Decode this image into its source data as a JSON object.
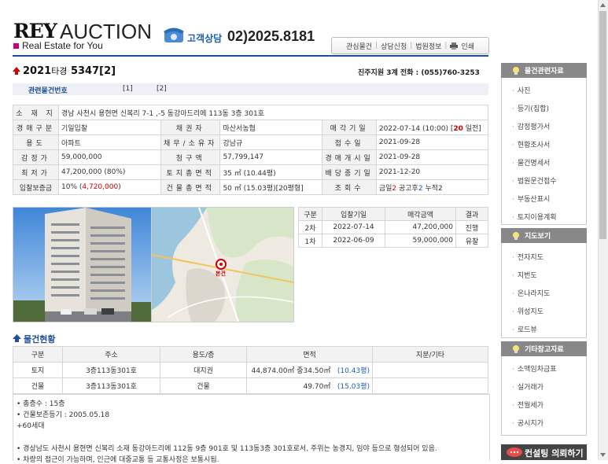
{
  "header": {
    "logo_main": "REY",
    "logo_auction": "AUCTION",
    "logo_sub": "Real Estate for You",
    "phone_label": "고객상담",
    "phone_number": "02)2025.8181",
    "top_links": [
      "관심물건",
      "상담신청",
      "법원정보",
      "인쇄"
    ]
  },
  "case": {
    "year": "2021",
    "type": "타경",
    "number": "5347[2]",
    "court": "진주지원 3계 전화 : (055)760-3253"
  },
  "related": {
    "label": "관련물건번호",
    "items": [
      "[1]",
      "[2]"
    ]
  },
  "info": {
    "address_label": "소 재 지",
    "address": "경남 사천시 용현면 신복리 7-1 ,-5 동강아드리에 113동 3층 301호",
    "rows": [
      {
        "l1": "경매구분",
        "v1": "기일입찰",
        "l2": "채권자",
        "v2": "마산서농협",
        "l3": "매각기일",
        "v3a": "2022-07-14 (10:00) [",
        "v3b": "20",
        "v3c": " 일전]"
      },
      {
        "l1": "용도",
        "v1": "아파트",
        "l2": "채무/소유자",
        "v2": "강남규",
        "l3": "접수일",
        "v3": "2021-09-28"
      },
      {
        "l1": "감정가",
        "v1": "59,000,000",
        "l2": "청구액",
        "v2": "57,799,147",
        "l3": "경매개시일",
        "v3": "2021-09-28"
      },
      {
        "l1": "최저가",
        "v1": "47,200,000 (80%)",
        "l2": "토지총면적",
        "v2": "35 ㎡ (10.44평)",
        "l3": "배당종기일",
        "v3": "2021-12-20"
      },
      {
        "l1": "입찰보증금",
        "v1a": "10% (",
        "v1b": "4,720,000",
        "v1c": ")",
        "l2": "건물총면적",
        "v2": "50 ㎡ (15.03평)[20평형]",
        "l3": "조회수",
        "v3a": "금일",
        "v3b": "2",
        "v3c": " 공고후",
        "v3d": "2",
        "v3e": " 누적",
        "v3f": "2"
      }
    ]
  },
  "map_marker_label": "본건",
  "history": {
    "headers": [
      "구분",
      "입찰기일",
      "매각금액",
      "결과"
    ],
    "rows": [
      [
        "2차",
        "2022-07-14",
        "47,200,000",
        "진행"
      ],
      [
        "1차",
        "2022-06-09",
        "59,000,000",
        "유찰"
      ]
    ]
  },
  "property": {
    "title": "물건현황",
    "headers": [
      "구분",
      "주소",
      "용도/층",
      "면적",
      "지분/기타"
    ],
    "rows": [
      {
        "kind": "토지",
        "addr": "3층113동301호",
        "use": "대지권",
        "area": "44,874.00㎡ 중34.50㎡",
        "pyeong": "(10.43평)",
        "etc": ""
      },
      {
        "kind": "건물",
        "addr": "3층113동301호",
        "use": "건물",
        "area": "49.70㎡",
        "pyeong": "(15.03평)",
        "etc": ""
      }
    ],
    "notes": [
      "• 총층수 : 15층",
      "• 건물보존등기 : 2005.05.18",
      "+60세대",
      "• 경상남도 사천시 용현면 신복리 소재 동강아드리에 112동 9층 901호 및 113동3층 301호로서, 주위는 농경지, 임야 등으로 형성되어 있음.",
      "• 차량의 접근이 가능하며, 인근에 대중교통 등 교통사정은 보통시됨."
    ]
  },
  "sidebar": {
    "sections": [
      {
        "title": "물건관련자료",
        "items": [
          "사진",
          "등기(집합)",
          "감정평가서",
          "현황조사서",
          "물건명세서",
          "법원문건접수",
          "부동산표시",
          "토지이용계획"
        ]
      },
      {
        "title": "지도보기",
        "items": [
          "전자지도",
          "지번도",
          "온나라지도",
          "위성지도",
          "로드뷰"
        ]
      },
      {
        "title": "기타참고자료",
        "items": [
          "소액임차금표",
          "실거래가",
          "전월세가",
          "공시지가"
        ]
      }
    ],
    "consult_label": "컨설팅 의뢰하기"
  },
  "colors": {
    "accent": "#1f4f96",
    "red": "#d10000",
    "magenta": "#c8007e",
    "blue": "#1a5fb4"
  }
}
